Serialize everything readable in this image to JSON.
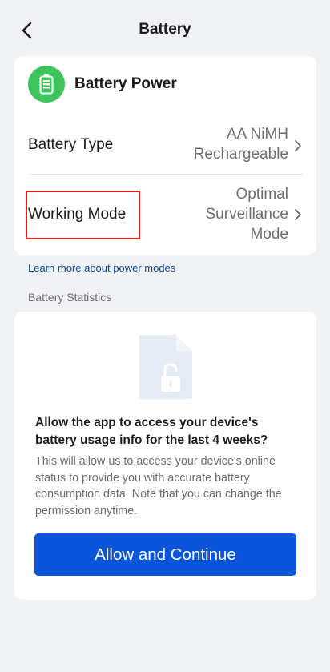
{
  "header": {
    "title": "Battery",
    "back_icon": "chevron-left-icon"
  },
  "battery_power": {
    "title": "Battery Power",
    "icon": "battery-icon",
    "icon_bg": "#3ec45c"
  },
  "settings": {
    "battery_type": {
      "label": "Battery Type",
      "value_lines": [
        "AA NiMH",
        "Rechargeable"
      ]
    },
    "working_mode": {
      "label": "Working Mode",
      "value_lines": [
        "Optimal",
        "Surveillance",
        "Mode"
      ],
      "highlighted": true,
      "highlight_color": "#e02020"
    }
  },
  "learn_more_link": "Learn more about power modes",
  "battery_statistics": {
    "section_label": "Battery Statistics",
    "title": "Allow the app to access your device's battery usage info for the last 4 weeks?",
    "description": "This will allow us to access your device's online status to provide you with accurate battery consumption data. Note that you can change the permission anytime.",
    "button_label": "Allow and Continue",
    "button_color": "#0a55d9",
    "illustration": "locked-document-icon"
  }
}
